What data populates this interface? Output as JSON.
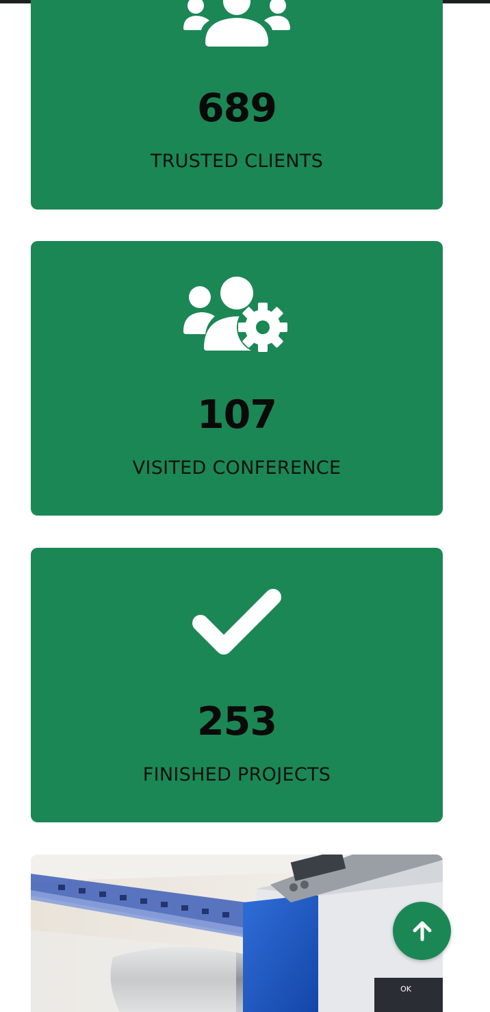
{
  "stats": [
    {
      "icon": "users-icon",
      "number": "689",
      "label": "TRUSTED CLIENTS"
    },
    {
      "icon": "users-cog-icon",
      "number": "107",
      "label": "VISITED CONFERENCE"
    },
    {
      "icon": "check-icon",
      "number": "253",
      "label": "FINISHED PROJECTS"
    }
  ],
  "image": {
    "subject": "large-format printer",
    "visible_marks": [
      "OK"
    ]
  },
  "scroll_top": {
    "icon": "arrow-up-icon"
  },
  "colors": {
    "card_green": "#1b8755",
    "text_dark": "#0b0b0b",
    "icon_white": "#ffffff",
    "background": "#ffffff"
  }
}
